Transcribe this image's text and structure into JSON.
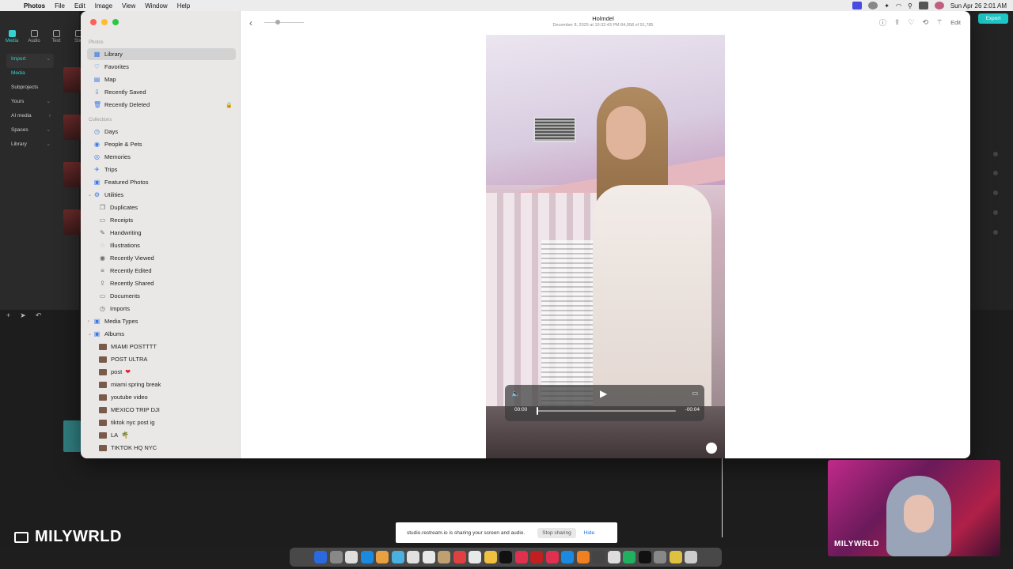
{
  "menubar": {
    "app": "Photos",
    "items": [
      "File",
      "Edit",
      "Image",
      "View",
      "Window",
      "Help"
    ],
    "clock": "Sun Apr 26  2:01 AM"
  },
  "editor": {
    "tools": [
      "Media",
      "Audio",
      "Text",
      "Stic"
    ],
    "nav": [
      "Import",
      "Media",
      "Subprojects",
      "Yours",
      "AI media",
      "Spaces",
      "Library"
    ],
    "export_label": "Export"
  },
  "photos": {
    "title": "Holmdel",
    "subtitle": "December 8, 2025 at 10:32:43 PM    84,058 of 91,785",
    "edit_label": "Edit",
    "sidebar": {
      "sections": {
        "photos": "Photos",
        "collections": "Collections"
      },
      "library": [
        {
          "label": "Library",
          "icon": "▦"
        },
        {
          "label": "Favorites",
          "icon": "♡"
        },
        {
          "label": "Map",
          "icon": "▤"
        },
        {
          "label": "Recently Saved",
          "icon": "⇩"
        },
        {
          "label": "Recently Deleted",
          "icon": "🗑"
        }
      ],
      "collections": [
        {
          "label": "Days",
          "icon": "◷"
        },
        {
          "label": "People & Pets",
          "icon": "◉"
        },
        {
          "label": "Memories",
          "icon": "◎"
        },
        {
          "label": "Trips",
          "icon": "✈"
        },
        {
          "label": "Featured Photos",
          "icon": "▣"
        },
        {
          "label": "Utilities",
          "icon": "⚙"
        }
      ],
      "utilities": [
        {
          "label": "Duplicates",
          "icon": "❐"
        },
        {
          "label": "Receipts",
          "icon": "▭"
        },
        {
          "label": "Handwriting",
          "icon": "✎"
        },
        {
          "label": "Illustrations",
          "icon": "◌"
        },
        {
          "label": "Recently Viewed",
          "icon": "◉"
        },
        {
          "label": "Recently Edited",
          "icon": "≡"
        },
        {
          "label": "Recently Shared",
          "icon": "⇪"
        },
        {
          "label": "Documents",
          "icon": "▭"
        },
        {
          "label": "Imports",
          "icon": "◷"
        }
      ],
      "media_types": "Media Types",
      "albums_header": "Albums",
      "albums": [
        "MIAMI POSTTTT",
        "POST ULTRA",
        "post",
        "miami spring break",
        "youtube video",
        "MEXICO TRIP DJI",
        "tiktok nyc post ig",
        "LA",
        "TIKTOK HQ NYC"
      ]
    },
    "video": {
      "current_time": "00:00",
      "remaining_time": "-00:04",
      "progress": 0.0
    }
  },
  "sharing": {
    "message": "studio.restream.io is sharing your screen and audio.",
    "stop_label": "Stop sharing",
    "hide_label": "Hide"
  },
  "overlay": {
    "brand": "MILYWRLD",
    "webcam_label": "MILYWRLD"
  },
  "colors": {
    "accent": "#3a78e7",
    "editor_accent": "#39d0d0",
    "selection": "#d2d2d2"
  }
}
